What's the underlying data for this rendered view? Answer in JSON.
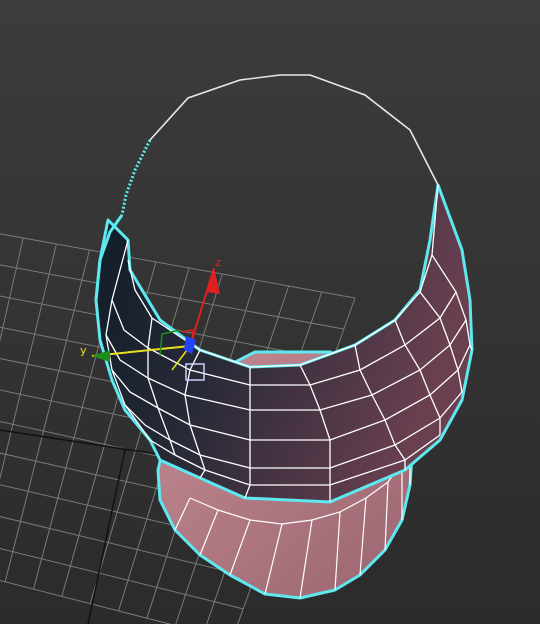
{
  "viewport": {
    "background_top": "#3c3c3c",
    "background_bottom": "#2a2a2a",
    "grid_color": "#7a7a7a",
    "grid_axis_color": "#111111",
    "selection_color": "#5ee8f0",
    "wire_color": "#ffffff",
    "bowl_dark": "#14232f",
    "bowl_light": "#5a3846",
    "base_color": "#b77a83"
  },
  "gizmo": {
    "x_color": "#e02020",
    "y_color": "#e8e020",
    "z_color": "#1d8f1d",
    "pivot_color": "#2244ff",
    "labels": {
      "z": "z",
      "y": "y"
    }
  }
}
